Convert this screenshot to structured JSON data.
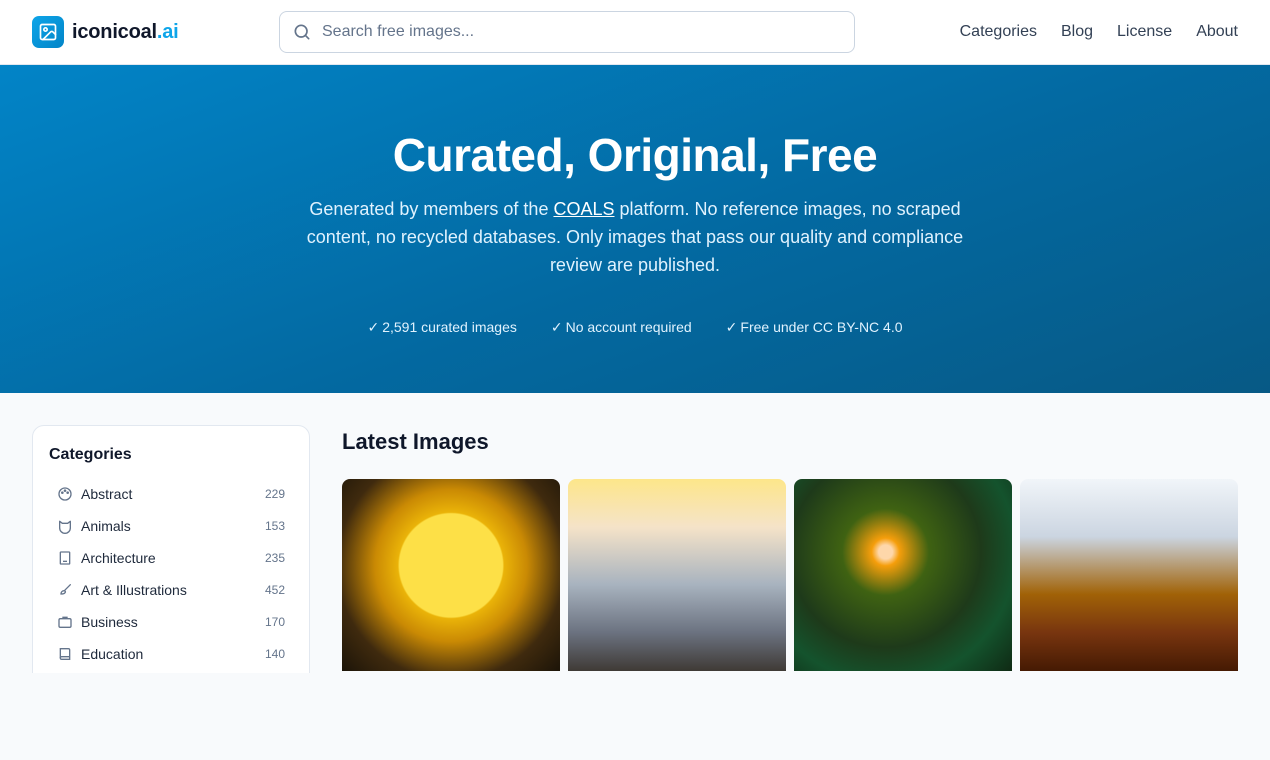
{
  "header": {
    "logo_main": "iconicoal",
    "logo_accent": ".ai",
    "search_placeholder": "Search free images...",
    "nav": [
      "Categories",
      "Blog",
      "License",
      "About"
    ]
  },
  "hero": {
    "title": "Curated, Original, Free",
    "desc_before": "Generated by members of the ",
    "desc_link": "COALS",
    "desc_after": " platform. No reference images, no scraped content, no recycled databases. Only images that pass our quality and compliance review are published.",
    "features": [
      "2,591 curated images",
      "No account required",
      "Free under CC BY-NC 4.0"
    ]
  },
  "sidebar": {
    "title": "Categories",
    "items": [
      {
        "label": "Abstract",
        "count": "229",
        "icon": "palette-icon"
      },
      {
        "label": "Animals",
        "count": "153",
        "icon": "cat-icon"
      },
      {
        "label": "Architecture",
        "count": "235",
        "icon": "building-icon"
      },
      {
        "label": "Art & Illustrations",
        "count": "452",
        "icon": "brush-icon"
      },
      {
        "label": "Business",
        "count": "170",
        "icon": "briefcase-icon"
      },
      {
        "label": "Education",
        "count": "140",
        "icon": "book-icon"
      }
    ]
  },
  "main": {
    "title": "Latest Images",
    "images": [
      {
        "name": "owl-clock-image"
      },
      {
        "name": "woman-tablet-image"
      },
      {
        "name": "forest-tree-image"
      },
      {
        "name": "classroom-child-image"
      }
    ]
  },
  "colors": {
    "brand": "#0ea5e9",
    "hero_start": "#0284c7",
    "hero_end": "#075985"
  }
}
